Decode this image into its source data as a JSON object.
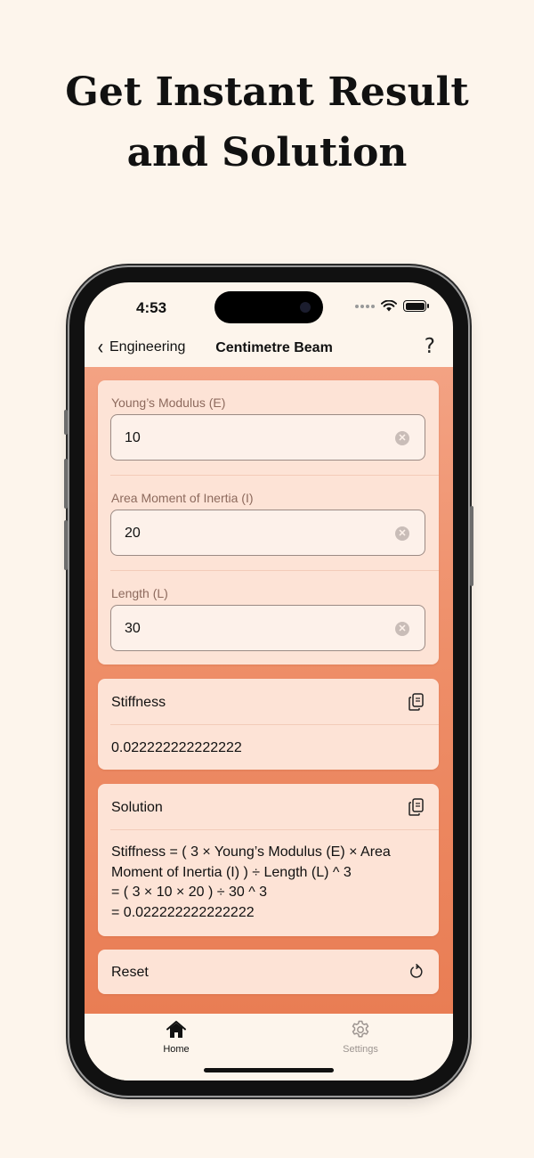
{
  "headline": {
    "line1": "Get Instant Result",
    "line2": "and Solution"
  },
  "status_bar": {
    "time": "4:53"
  },
  "nav": {
    "back_label": "Engineering",
    "title": "Centimetre Beam",
    "help_label": "?"
  },
  "inputs": [
    {
      "label": "Young’s Modulus (E)",
      "value": "10"
    },
    {
      "label": "Area Moment of Inertia (I)",
      "value": "20"
    },
    {
      "label": "Length (L)",
      "value": "30"
    }
  ],
  "result": {
    "title": "Stiffness",
    "value": "0.022222222222222"
  },
  "solution": {
    "title": "Solution",
    "lines": [
      "Stiffness = ( 3 × Young’s Modulus (E) × Area",
      "Moment of Inertia (I) ) ÷ Length (L) ^ 3",
      "= ( 3 × 10 × 20 ) ÷ 30 ^ 3",
      "= 0.022222222222222"
    ]
  },
  "reset": {
    "label": "Reset"
  },
  "tabs": [
    {
      "label": "Home",
      "icon": "home-icon",
      "active": true
    },
    {
      "label": "Settings",
      "icon": "gear-icon",
      "active": false
    }
  ],
  "colors": {
    "background": "#fdf5ec",
    "accent": "#ee8e68",
    "card": "#fde3d6",
    "inactive_tab": "#9c9490"
  }
}
